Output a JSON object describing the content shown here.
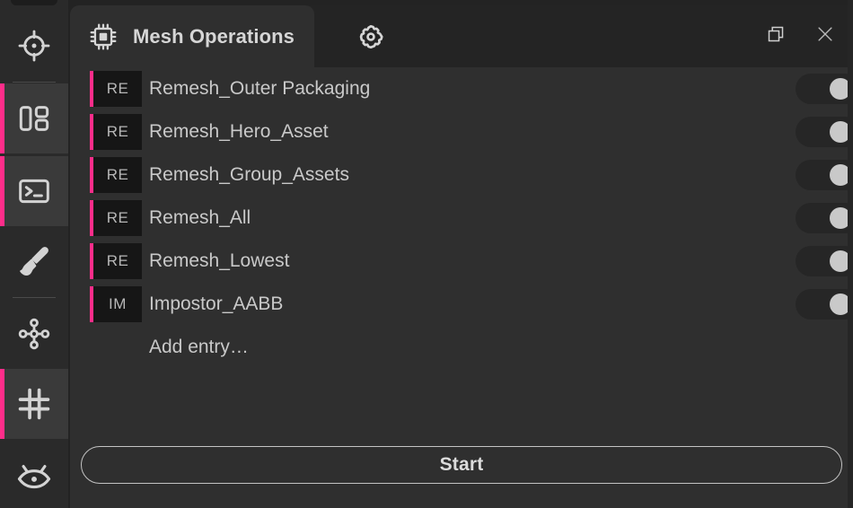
{
  "theme": {
    "accent": "#ff2d8a",
    "panel_bg": "#2f2f2f",
    "titlebar_bg": "#242424",
    "rail_bg": "#2a2a2a",
    "badge_bg": "#161616",
    "text": "#c9c9c9"
  },
  "rail": {
    "items": [
      {
        "id": "target-icon",
        "name": "target-icon",
        "active": false
      },
      {
        "id": "layout-icon",
        "name": "layout-icon",
        "active": true
      },
      {
        "id": "terminal-icon",
        "name": "terminal-icon",
        "active": true
      },
      {
        "id": "brush-icon",
        "name": "brush-icon",
        "active": false
      },
      {
        "id": "node-graph-icon",
        "name": "node-graph-icon",
        "active": false
      },
      {
        "id": "grid-icon",
        "name": "grid-icon",
        "active": true
      },
      {
        "id": "eye-icon",
        "name": "eye-icon",
        "active": false
      }
    ]
  },
  "titlebar": {
    "tab_title": "Mesh Operations",
    "tab_icon": "chip-icon",
    "settings_tab_icon": "gear-icon",
    "restore_icon": "restore-window-icon",
    "close_icon": "close-icon"
  },
  "list": {
    "rows": [
      {
        "badge": "RE",
        "label": "Remesh_Outer Packaging",
        "enabled": true
      },
      {
        "badge": "RE",
        "label": "Remesh_Hero_Asset",
        "enabled": true
      },
      {
        "badge": "RE",
        "label": "Remesh_Group_Assets",
        "enabled": true
      },
      {
        "badge": "RE",
        "label": "Remesh_All",
        "enabled": true
      },
      {
        "badge": "RE",
        "label": "Remesh_Lowest",
        "enabled": true
      },
      {
        "badge": "IM",
        "label": "Impostor_AABB",
        "enabled": true
      }
    ],
    "add_entry_label": "Add entry…"
  },
  "footer": {
    "start_label": "Start"
  }
}
